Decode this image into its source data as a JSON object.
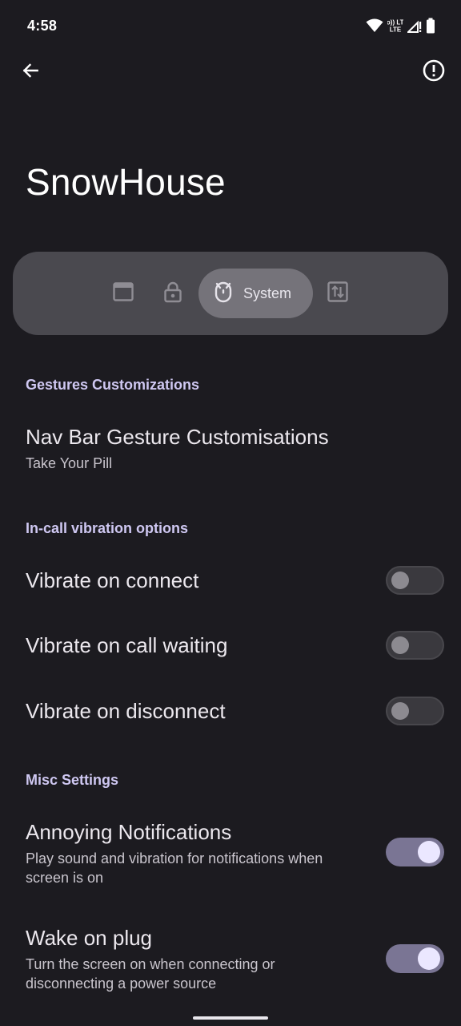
{
  "status_bar": {
    "time": "4:58",
    "icons": [
      "wifi-icon",
      "volte-icon",
      "signal-icon",
      "battery-icon"
    ],
    "volte_text": "Vo)) LTE"
  },
  "top_bar": {
    "back_icon": "arrow-back-icon",
    "info_icon": "info-outline-icon"
  },
  "page": {
    "title": "SnowHouse"
  },
  "tabs": {
    "items": [
      {
        "icon": "window-icon",
        "label": ""
      },
      {
        "icon": "lock-icon",
        "label": ""
      },
      {
        "icon": "system-icon",
        "label": "System",
        "selected": true
      },
      {
        "icon": "swap-vertical-icon",
        "label": ""
      }
    ]
  },
  "sections": {
    "gestures": {
      "header": "Gestures Customizations",
      "nav_bar": {
        "title": "Nav Bar Gesture Customisations",
        "summary": "Take Your Pill"
      }
    },
    "incall": {
      "header": "In-call vibration options",
      "items": [
        {
          "title": "Vibrate on connect",
          "checked": false
        },
        {
          "title": "Vibrate on call waiting",
          "checked": false
        },
        {
          "title": "Vibrate on disconnect",
          "checked": false
        }
      ]
    },
    "misc": {
      "header": "Misc Settings",
      "items": [
        {
          "title": "Annoying Notifications",
          "summary": "Play sound and vibration for notifications when screen is on",
          "checked": true
        },
        {
          "title": "Wake on plug",
          "summary": "Turn the screen on when connecting or disconnecting a power source",
          "checked": true
        }
      ]
    }
  },
  "colors": {
    "background": "#1c1b20",
    "accent": "#cfc8f2",
    "switch_on_track": "#7a7594",
    "switch_on_thumb": "#ebe7ff",
    "tab_strip": "#4a494f",
    "tab_selected": "#75737a"
  }
}
